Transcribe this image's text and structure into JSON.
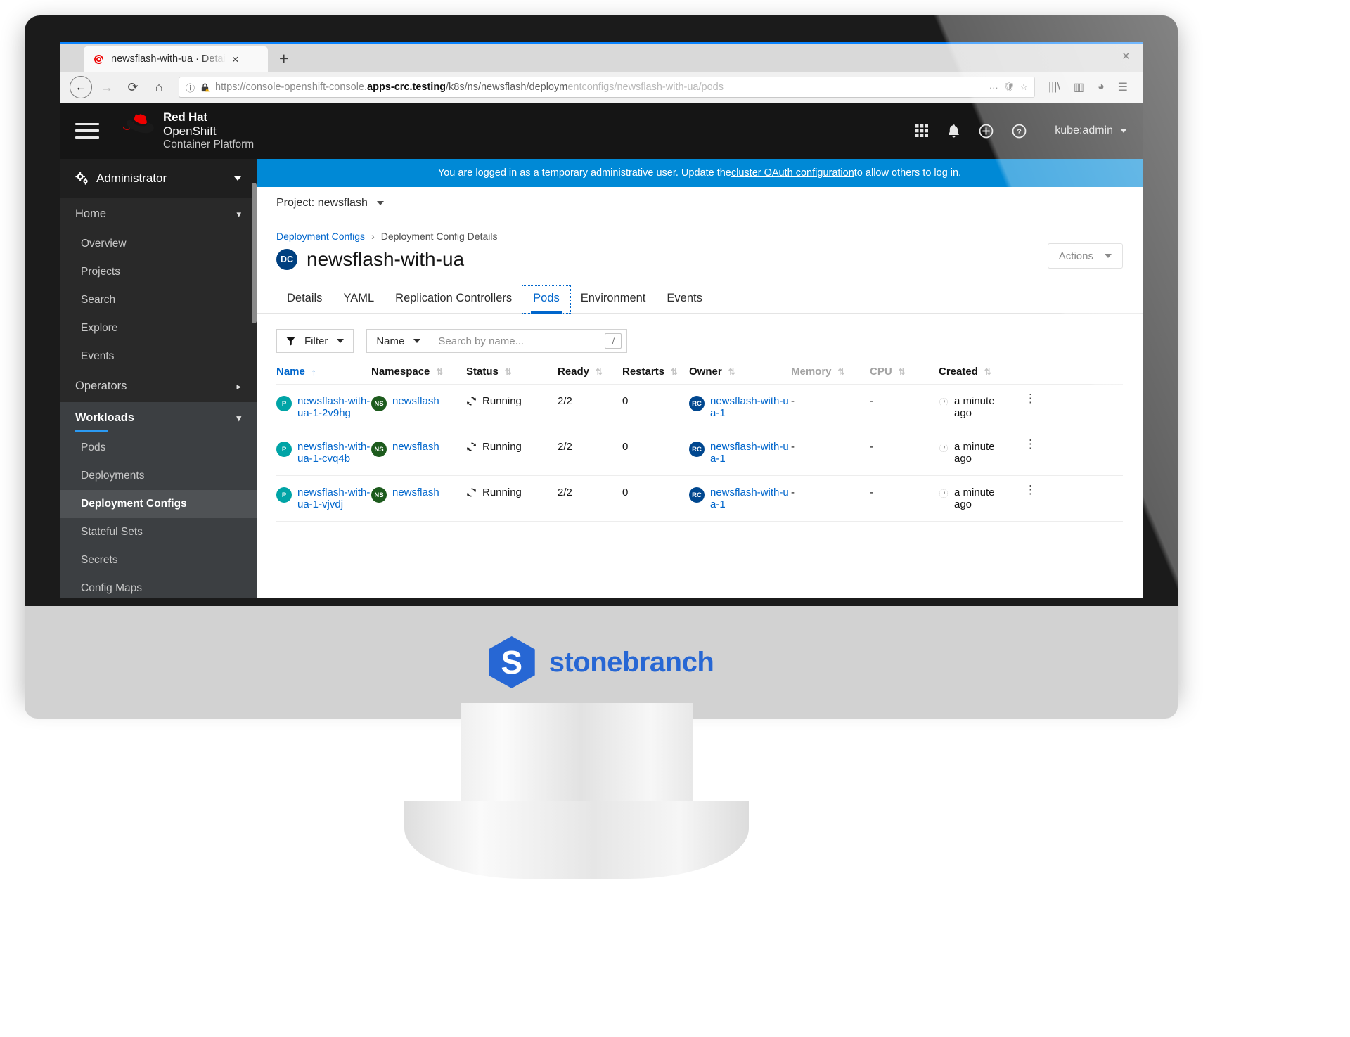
{
  "browser": {
    "tab_title": "newsflash-with-ua · Detai",
    "favicon": "openshift-icon",
    "new_tab_label": "+",
    "close_tab_label": "×",
    "window_close_label": "×",
    "url_scheme": "https://console-openshift-console.",
    "url_domain": "apps-crc.testing",
    "url_path": "/k8s/ns/newsflash/deploym",
    "url_tail": "entconfigs/newsflash-with-ua/pods",
    "back_label": "←",
    "forward_label": "→",
    "reload_label": "⟳",
    "home_label": "⌂",
    "page_actions_label": "···",
    "shield_label": "🛡",
    "bookmark_label": "☆",
    "library_label": "|||\\",
    "sidebars_label": "▥",
    "account_label": "◕",
    "menu_label": "☰"
  },
  "masthead": {
    "brand_line_1": "Red Hat",
    "brand_line_2": "OpenShift",
    "brand_line_3": "Container Platform",
    "hamburger_name": "navigation-toggle",
    "user_name": "kube:admin",
    "tools": [
      {
        "name": "application-launcher-icon",
        "label": "Application launcher"
      },
      {
        "name": "bell-icon",
        "label": "Notifications"
      },
      {
        "name": "plus-circle-icon",
        "label": "Add"
      },
      {
        "name": "help-circle-icon",
        "label": "Help"
      }
    ]
  },
  "sidebar": {
    "perspective": "Administrator",
    "sections": [
      {
        "label": "Home",
        "expanded": true,
        "active": false,
        "items": [
          {
            "label": "Overview",
            "selected": false
          },
          {
            "label": "Projects",
            "selected": false
          },
          {
            "label": "Search",
            "selected": false
          },
          {
            "label": "Explore",
            "selected": false
          },
          {
            "label": "Events",
            "selected": false
          }
        ]
      },
      {
        "label": "Operators",
        "expanded": false,
        "active": false,
        "items": []
      },
      {
        "label": "Workloads",
        "expanded": true,
        "active": true,
        "items": [
          {
            "label": "Pods",
            "selected": false
          },
          {
            "label": "Deployments",
            "selected": false
          },
          {
            "label": "Deployment Configs",
            "selected": true
          },
          {
            "label": "Stateful Sets",
            "selected": false
          },
          {
            "label": "Secrets",
            "selected": false
          },
          {
            "label": "Config Maps",
            "selected": false
          }
        ]
      }
    ]
  },
  "banner": {
    "text_before": "You are logged in as a temporary administrative user. Update the ",
    "link_text": "cluster OAuth configuration",
    "text_after": " to allow others to log in."
  },
  "project_bar": {
    "label": "Project: newsflash"
  },
  "page": {
    "breadcrumb_parent": "Deployment Configs",
    "breadcrumb_sep": "›",
    "breadcrumb_current": "Deployment Config Details",
    "badge": "DC",
    "title": "newsflash-with-ua",
    "actions_label": "Actions"
  },
  "tabs": [
    {
      "label": "Details",
      "active": false
    },
    {
      "label": "YAML",
      "active": false
    },
    {
      "label": "Replication Controllers",
      "active": false
    },
    {
      "label": "Pods",
      "active": true
    },
    {
      "label": "Environment",
      "active": false
    },
    {
      "label": "Events",
      "active": false
    }
  ],
  "toolbar": {
    "filter_label": "Filter",
    "filter_icon": "funnel-icon",
    "search_attribute": "Name",
    "search_placeholder": "Search by name...",
    "search_value": "",
    "search_shortcut": "/"
  },
  "table": {
    "columns": [
      {
        "key": "name",
        "label": "Name",
        "sorted": true,
        "sort_dir": "asc",
        "muted": false
      },
      {
        "key": "ns",
        "label": "Namespace",
        "sorted": false,
        "muted": false
      },
      {
        "key": "status",
        "label": "Status",
        "sorted": false,
        "muted": false
      },
      {
        "key": "ready",
        "label": "Ready",
        "sorted": false,
        "muted": false
      },
      {
        "key": "restarts",
        "label": "Restarts",
        "sorted": false,
        "muted": false
      },
      {
        "key": "owner",
        "label": "Owner",
        "sorted": false,
        "muted": false
      },
      {
        "key": "memory",
        "label": "Memory",
        "sorted": false,
        "muted": true
      },
      {
        "key": "cpu",
        "label": "CPU",
        "sorted": false,
        "muted": true
      },
      {
        "key": "created",
        "label": "Created",
        "sorted": false,
        "muted": false
      }
    ],
    "sort_asc_glyph": "↑",
    "sort_none_glyph": "⇅",
    "kebab_glyph": "⋮",
    "status_icon": "sync-icon",
    "created_icon": "globe-clock-icon",
    "rows": [
      {
        "name": "newsflash-with-ua-1-2v9hg",
        "name_badge": "P",
        "namespace": "newsflash",
        "namespace_badge": "NS",
        "status": "Running",
        "ready": "2/2",
        "restarts": "0",
        "owner": "newsflash-with-ua-1",
        "owner_badge": "RC",
        "memory": "-",
        "cpu": "-",
        "created": "a minute ago"
      },
      {
        "name": "newsflash-with-ua-1-cvq4b",
        "name_badge": "P",
        "namespace": "newsflash",
        "namespace_badge": "NS",
        "status": "Running",
        "ready": "2/2",
        "restarts": "0",
        "owner": "newsflash-with-ua-1",
        "owner_badge": "RC",
        "memory": "-",
        "cpu": "-",
        "created": "a minute ago"
      },
      {
        "name": "newsflash-with-ua-1-vjvdj",
        "name_badge": "P",
        "namespace": "newsflash",
        "namespace_badge": "NS",
        "status": "Running",
        "ready": "2/2",
        "restarts": "0",
        "owner": "newsflash-with-ua-1",
        "owner_badge": "RC",
        "memory": "-",
        "cpu": "-",
        "created": "a minute ago"
      }
    ]
  },
  "monitor": {
    "brand_mark": "S",
    "brand_name": "stonebranch",
    "brand_color": "#2767d4"
  }
}
